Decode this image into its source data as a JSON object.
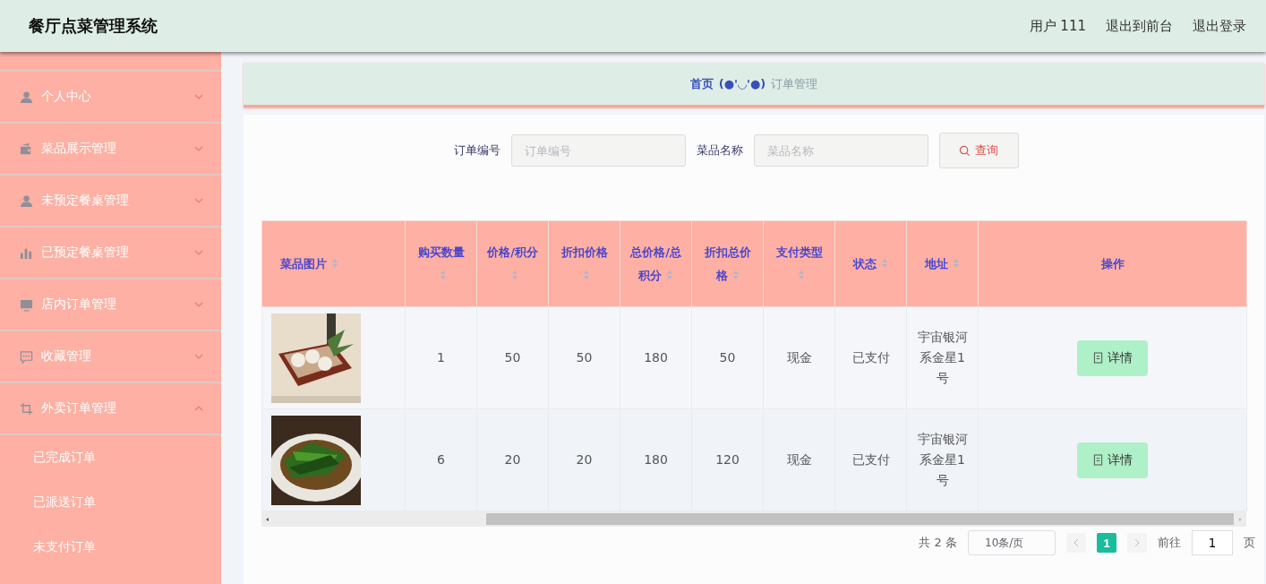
{
  "header": {
    "title": "餐厅点菜管理系统",
    "links": [
      "用户 111",
      "退出到前台",
      "退出登录"
    ]
  },
  "sidebar": {
    "items": [
      {
        "label": "个人中心",
        "expanded": false
      },
      {
        "label": "菜品展示管理",
        "expanded": false
      },
      {
        "label": "未预定餐桌管理",
        "expanded": false
      },
      {
        "label": "已预定餐桌管理",
        "expanded": false
      },
      {
        "label": "店内订单管理",
        "expanded": false
      },
      {
        "label": "收藏管理",
        "expanded": false
      },
      {
        "label": "外卖订单管理",
        "expanded": true,
        "children": [
          {
            "label": "已完成订单"
          },
          {
            "label": "已派送订单"
          },
          {
            "label": "未支付订单"
          }
        ]
      }
    ]
  },
  "breadcrumb": {
    "home": "首页",
    "separator": "(●'◡'●)",
    "current": "订单管理"
  },
  "search": {
    "fields": [
      {
        "label": "订单编号",
        "placeholder": "订单编号"
      },
      {
        "label": "菜品名称",
        "placeholder": "菜品名称"
      }
    ],
    "button": "查询"
  },
  "table": {
    "columns": [
      {
        "label": "菜品图片",
        "sortable": true
      },
      {
        "label": "购买数量",
        "sortable": true
      },
      {
        "label": "价格/积分",
        "sortable": true
      },
      {
        "label": "折扣价格",
        "sortable": true
      },
      {
        "label": "总价格/总积分",
        "sortable": true
      },
      {
        "label": "折扣总价格",
        "sortable": true
      },
      {
        "label": "支付类型",
        "sortable": true
      },
      {
        "label": "状态",
        "sortable": true
      },
      {
        "label": "地址",
        "sortable": true
      },
      {
        "label": "操作",
        "sortable": false
      }
    ],
    "rows": [
      {
        "cells": [
          {
            "kind": "picture"
          },
          "1",
          "50",
          "50",
          "180",
          "50",
          "现金",
          "已支付",
          "宇宙银河系金星1号",
          {
            "kind": "button",
            "label": "详情"
          }
        ]
      },
      {
        "cells": [
          {
            "kind": "picture"
          },
          "6",
          "20",
          "20",
          "180",
          "120",
          "现金",
          "已支付",
          "宇宙银河系金星1号",
          {
            "kind": "button",
            "label": "详情"
          }
        ]
      }
    ]
  },
  "pagination": {
    "total": "共 2 条",
    "page_size": "10条/页",
    "pages": [
      {
        "label": "1",
        "selected": true
      }
    ],
    "goto": "前往",
    "goto_value": "1",
    "goto_suffix": "页"
  }
}
